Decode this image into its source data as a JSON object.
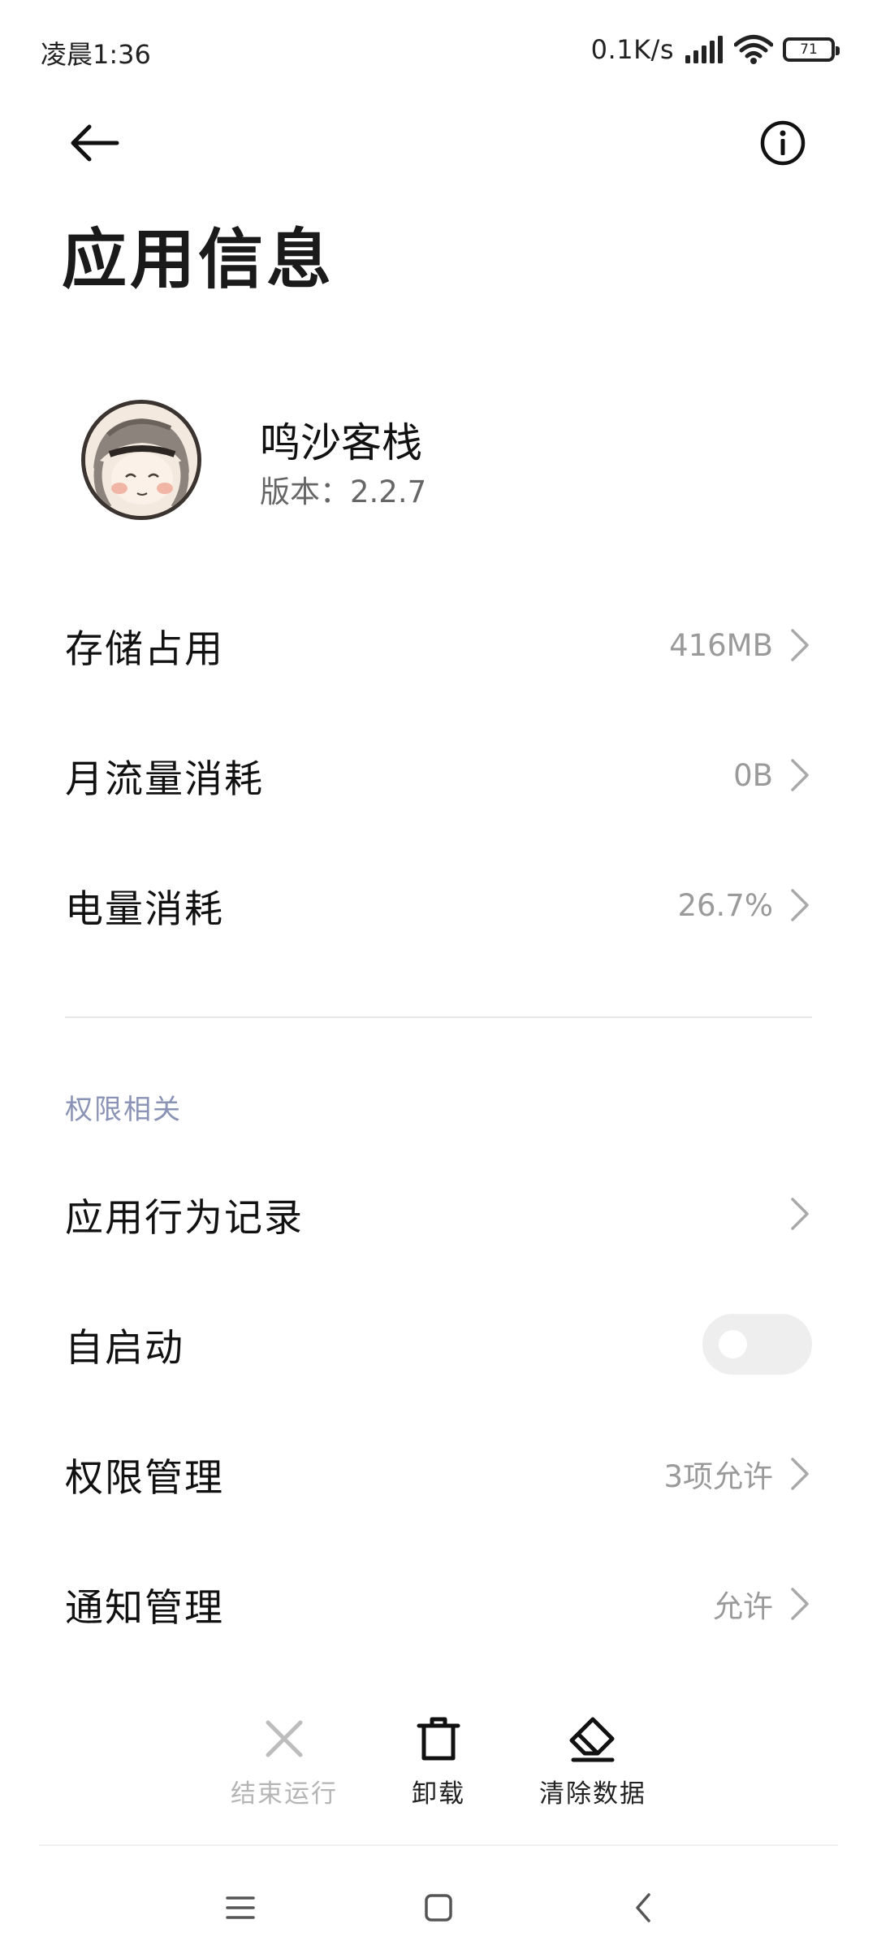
{
  "status_bar": {
    "time": "凌晨1:36",
    "net_speed": "0.1K/s",
    "battery_level": "71",
    "icons": [
      "signal-icon",
      "wifi-icon",
      "battery-icon"
    ]
  },
  "header": {
    "back_icon": "arrow-left-icon",
    "info_icon": "info-circle-icon",
    "title": "应用信息"
  },
  "app": {
    "name": "鸣沙客栈",
    "version": "版本：2.2.7"
  },
  "usage_rows": [
    {
      "label": "存储占用",
      "value": "416MB"
    },
    {
      "label": "月流量消耗",
      "value": "0B"
    },
    {
      "label": "电量消耗",
      "value": "26.7%"
    }
  ],
  "permissions": {
    "section_label": "权限相关",
    "behavior_log": {
      "label": "应用行为记录"
    },
    "autostart": {
      "label": "自启动",
      "enabled": false
    },
    "permission_mgmt": {
      "label": "权限管理",
      "value": "3项允许"
    },
    "notification_mgmt": {
      "label": "通知管理",
      "value": "允许"
    }
  },
  "actions": {
    "force_stop": {
      "label": "结束运行",
      "enabled": false
    },
    "uninstall": {
      "label": "卸载",
      "enabled": true
    },
    "clear_data": {
      "label": "清除数据",
      "enabled": true
    }
  },
  "nav": {
    "icons": [
      "menu-icon",
      "home-square-icon",
      "back-chevron-icon"
    ]
  },
  "colors": {
    "section_label": "#8a93b6",
    "value_gray": "#9a9a9a",
    "toggle_off": "#eeeeee"
  }
}
